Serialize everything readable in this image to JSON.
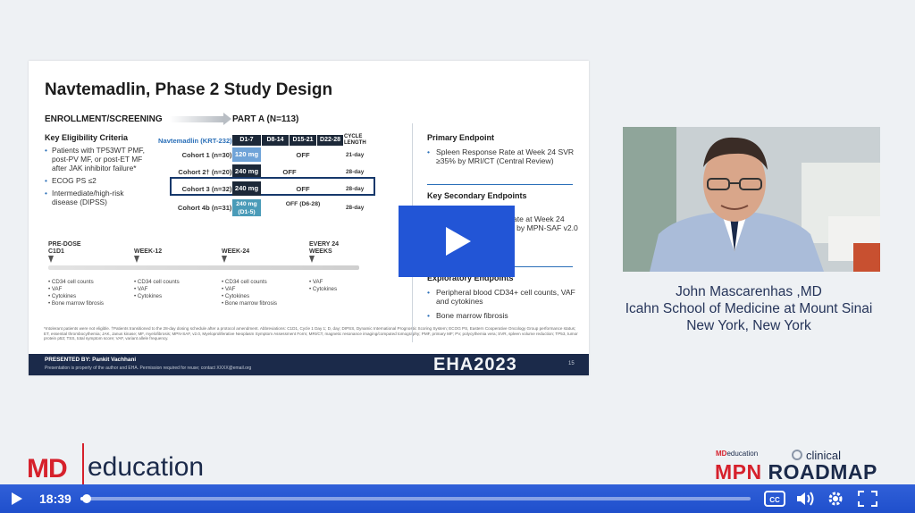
{
  "slide": {
    "title": "Navtemadlin, Phase 2 Study Design",
    "enrollment": "ENROLLMENT/SCREENING",
    "part_a": "PART A (N=113)",
    "eligibility": {
      "title": "Key Eligibility Criteria",
      "items": [
        "Patients with TP53WT PMF, post-PV MF, or post-ET MF after JAK inhibitor failure*",
        "ECOG PS ≤2",
        "Intermediate/high-risk disease (DIPSS)"
      ]
    },
    "table": {
      "drug_label": "Navtemadlin (KRT-232)",
      "columns": [
        "D1-7",
        "D8-14",
        "D15-21",
        "D22-28"
      ],
      "cycle_header": "CYCLE LENGTH",
      "rows": [
        {
          "label": "Cohort 1 (n=30):",
          "dose": "120 mg",
          "off": "OFF",
          "cycle": "21-day",
          "color": "#6fa3d8"
        },
        {
          "label": "Cohort 2† (n=20):",
          "dose": "240 mg",
          "off": "OFF",
          "cycle": "28-day",
          "color": "#1c2838"
        },
        {
          "label": "Cohort 3 (n=32):",
          "dose": "240 mg",
          "off": "OFF",
          "cycle": "28-day",
          "color": "#1c2838"
        },
        {
          "label": "Cohort 4b (n=31):",
          "dose": "240 mg (D1-5)",
          "off": "OFF (D6-28)",
          "cycle": "28-day",
          "color": "#4a9bb8"
        }
      ]
    },
    "timeline": [
      {
        "label": "PRE-DOSE C1D1",
        "items": [
          "CD34 cell counts",
          "VAF",
          "Cytokines",
          "Bone marrow fibrosis"
        ]
      },
      {
        "label": "WEEK-12",
        "items": [
          "CD34 cell counts",
          "VAF",
          "Cytokines"
        ]
      },
      {
        "label": "WEEK-24",
        "items": [
          "CD34 cell counts",
          "VAF",
          "Cytokines",
          "Bone marrow fibrosis"
        ]
      },
      {
        "label": "EVERY 24 WEEKS",
        "items": [
          "VAF",
          "Cytokines"
        ]
      }
    ],
    "notes": "*Intolerant patients were not eligible. †Patients transitioned to the 28-day dosing schedule after a protocol amendment. Abbreviations: C1D1, Cycle 1 Day 1; D, day; DIPSS, Dynamic International Prognostic Scoring System; ECOG PS, Eastern Cooperative Oncology Group performance status; ET, essential thrombocythemia; JAK, Janus kinase; MF, myelofibrosis; MPN-SAF, v2.0, Myeloproliferative Neoplasm Symptom Assessment Form; MRI/CT, magnetic resonance imaging/computed tomography; PMF, primary MF; PV, polycythemia vera; SVR, spleen volume reduction; TP53, tumor protein p53; TSS, total symptom score; VAF, variant allele frequency.",
    "endpoints": {
      "primary_title": "Primary Endpoint",
      "primary_item": "Spleen Response Rate at Week 24 SVR ≥35% by MRI/CT (Central Review)",
      "secondary_title": "Key Secondary Endpoints",
      "secondary_item": "Symptom Response Rate at Week 24 ≥50% reduction in TSS by MPN-SAF v2.0",
      "exploratory_title": "Exploratory Endpoints",
      "exploratory_items": [
        "Peripheral blood CD34+ cell counts, VAF and cytokines",
        "Bone marrow fibrosis"
      ]
    },
    "footer": {
      "presented_by": "PRESENTED BY: Pankit Vachhani",
      "property": "Presentation is property of the author and EHA. Permission required for reuse; contact XXXX@email.org",
      "event": "EHA2023",
      "page": "15"
    }
  },
  "speaker": {
    "name": "John Mascarenhas ,MD",
    "affiliation": "Icahn School of Medicine at Mount Sinai",
    "location": "New York, New York"
  },
  "branding": {
    "md": "MD",
    "education": "education",
    "roadmap_md": "MD",
    "roadmap_education": "education",
    "clinical": "clinical",
    "mpn": "MPN",
    "roadmap": "ROADMAP"
  },
  "player": {
    "time": "18:39",
    "progress": 0.01,
    "accent": "#2255d6"
  }
}
